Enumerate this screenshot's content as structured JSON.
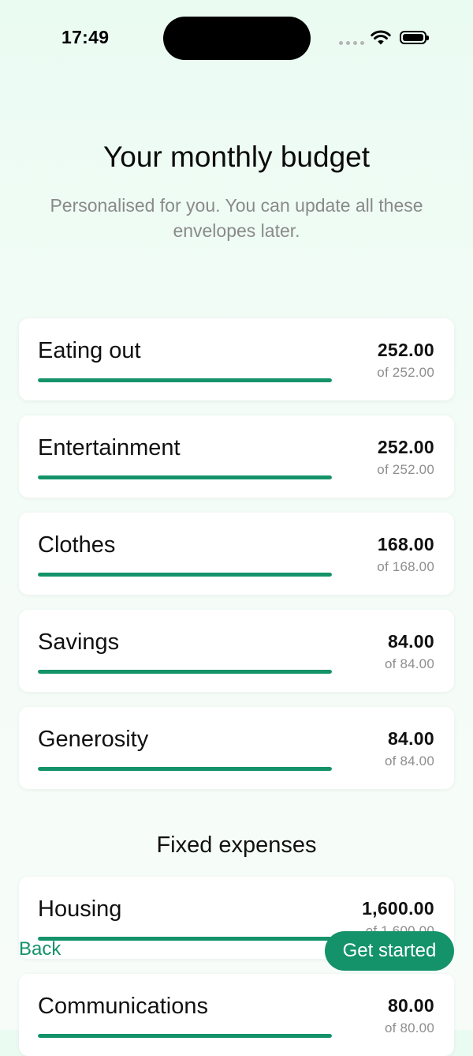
{
  "status_bar": {
    "time": "17:49"
  },
  "header": {
    "title": "Your monthly budget",
    "subtitle": "Personalised for you. You can update all these envelopes later."
  },
  "envelopes": [
    {
      "name": "Eating out",
      "amount": "252.00",
      "of_label": "of 252.00",
      "fill_fraction": 1.0
    },
    {
      "name": "Entertainment",
      "amount": "252.00",
      "of_label": "of 252.00",
      "fill_fraction": 1.0
    },
    {
      "name": "Clothes",
      "amount": "168.00",
      "of_label": "of 168.00",
      "fill_fraction": 1.0
    },
    {
      "name": "Savings",
      "amount": "84.00",
      "of_label": "of 84.00",
      "fill_fraction": 1.0
    },
    {
      "name": "Generosity",
      "amount": "84.00",
      "of_label": "of 84.00",
      "fill_fraction": 1.0
    }
  ],
  "fixed_section": {
    "title": "Fixed expenses",
    "items": [
      {
        "name": "Housing",
        "amount": "1,600.00",
        "of_label": "of 1,600.00",
        "fill_fraction": 1.0
      },
      {
        "name": "Communications",
        "amount": "80.00",
        "of_label": "of 80.00",
        "fill_fraction": 1.0
      }
    ]
  },
  "footer": {
    "back_label": "Back",
    "primary_label": "Get started"
  },
  "colors": {
    "accent": "#14936a",
    "background": "#eafbf2",
    "card": "#ffffff",
    "muted_text": "#8a8a8a"
  }
}
